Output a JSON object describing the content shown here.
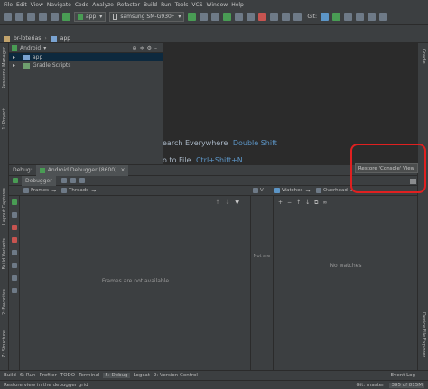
{
  "menu": [
    "File",
    "Edit",
    "View",
    "Navigate",
    "Code",
    "Analyze",
    "Refactor",
    "Build",
    "Run",
    "Tools",
    "VCS",
    "Window",
    "Help"
  ],
  "toolbar": {
    "config": "app",
    "device": "samsung SM-G930F",
    "git_label": "Git:"
  },
  "breadcrumb": {
    "project": "br-loterias",
    "module": "app"
  },
  "project_panel": {
    "view_mode": "Android",
    "items": [
      {
        "label": "app",
        "selected": true
      },
      {
        "label": "Gradle Scripts",
        "selected": false
      }
    ]
  },
  "left_tool_windows": {
    "resource_manager": "Resource Manager",
    "project": "1: Project",
    "layout_captures": "Layout Captures",
    "build_variants": "Build Variants",
    "favorites": "2: Favorites",
    "structure": "Z: Structure"
  },
  "right_tool_windows": {
    "gradle": "Gradle",
    "device_file_explorer": "Device File Explorer"
  },
  "editor_hints": {
    "search_everywhere_label": "earch Everywhere",
    "search_everywhere_key": "Double Shift",
    "goto_file_label": "o to File",
    "goto_file_key": "Ctrl+Shift+N"
  },
  "debug_panel": {
    "tab_debug": "Debug:",
    "tab_session": "Android Debugger (8600)",
    "subtab_debugger": "Debugger",
    "frames_label": "Frames",
    "threads_label": "Threads",
    "variables_label": "V",
    "watches_label": "Watches",
    "overhead_label": "Overhead",
    "frames_empty": "Frames are not available",
    "variables_empty": "Not are",
    "watches_empty": "No watches"
  },
  "tooltip": {
    "text": "Restore 'Console' View"
  },
  "bottom_tools": [
    "Build",
    "6: Run",
    "Profiler",
    "TODO",
    "Terminal",
    "5: Debug",
    "Logcat",
    "9: Version Control"
  ],
  "event_log": "Event Log",
  "status": {
    "message": "Restore view in the debugger grid",
    "git": "Git: master",
    "memory": "395 of 815M"
  },
  "colors": {
    "accent_highlight": "#e02020",
    "link_blue": "#5c95c6",
    "selection": "#0d293e",
    "run_green": "#499c54"
  }
}
